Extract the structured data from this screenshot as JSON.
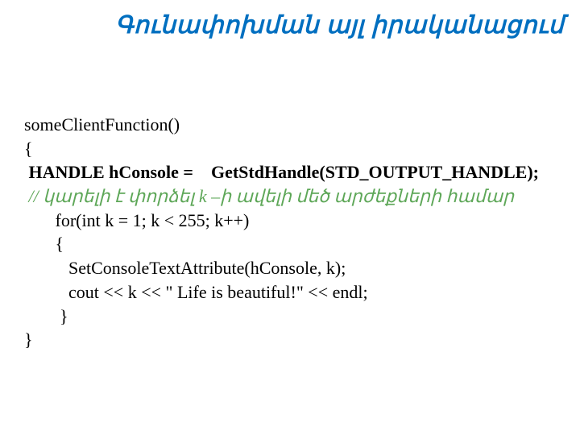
{
  "title": "Գունափոխման այլ իրականացում",
  "code": {
    "l1": "someClientFunction()",
    "l2": "{",
    "l3": " HANDLE hConsole =    GetStdHandle(STD_OUTPUT_HANDLE);",
    "l4": " // կարելի է փորձել k –ի ավելի մեծ արժեքների համար",
    "l5": "       for(int k = 1; k < 255; k++)",
    "l6": "       {",
    "l7": "          SetConsoleTextAttribute(hConsole, k);",
    "l8": "          cout << k << \" Life is beautiful!\" << endl;",
    "l9": "        }",
    "l10": "}"
  }
}
